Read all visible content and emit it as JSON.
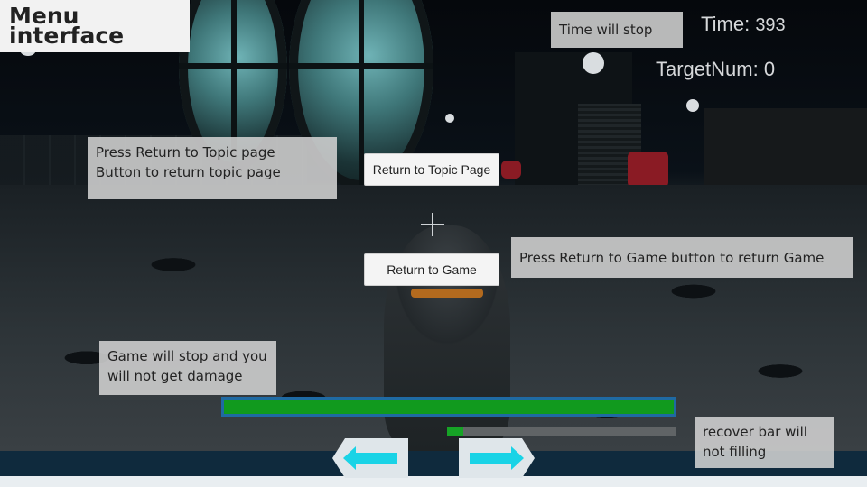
{
  "title": "Menu interface",
  "hud": {
    "time_label": "Time:",
    "time_value": "393",
    "target_label": "TargetNum:",
    "target_value": "0"
  },
  "buttons": {
    "return_topic": "Return to Topic Page",
    "return_game": "Return to Game"
  },
  "notes": {
    "time": "Time will stop",
    "topic_line1": "Press Return to Topic page",
    "topic_line2": "Button  to return topic page",
    "game": "Press Return to Game button to return Game",
    "damage_line1": "Game will stop and you",
    "damage_line2": "will not get damage",
    "recover_line1": "recover bar will",
    "recover_line2": "not filling"
  },
  "bars": {
    "health_fraction": 1.0,
    "recover_fraction": 0.07
  },
  "colors": {
    "health_fill": "#119a1e",
    "health_border": "#1f6aa3",
    "recover_fill": "#16a326",
    "arrow_fill": "#19d3e6"
  },
  "icons": {
    "left_arrow": "arrow-left-icon",
    "right_arrow": "arrow-right-icon",
    "crosshair": "crosshair-icon"
  }
}
